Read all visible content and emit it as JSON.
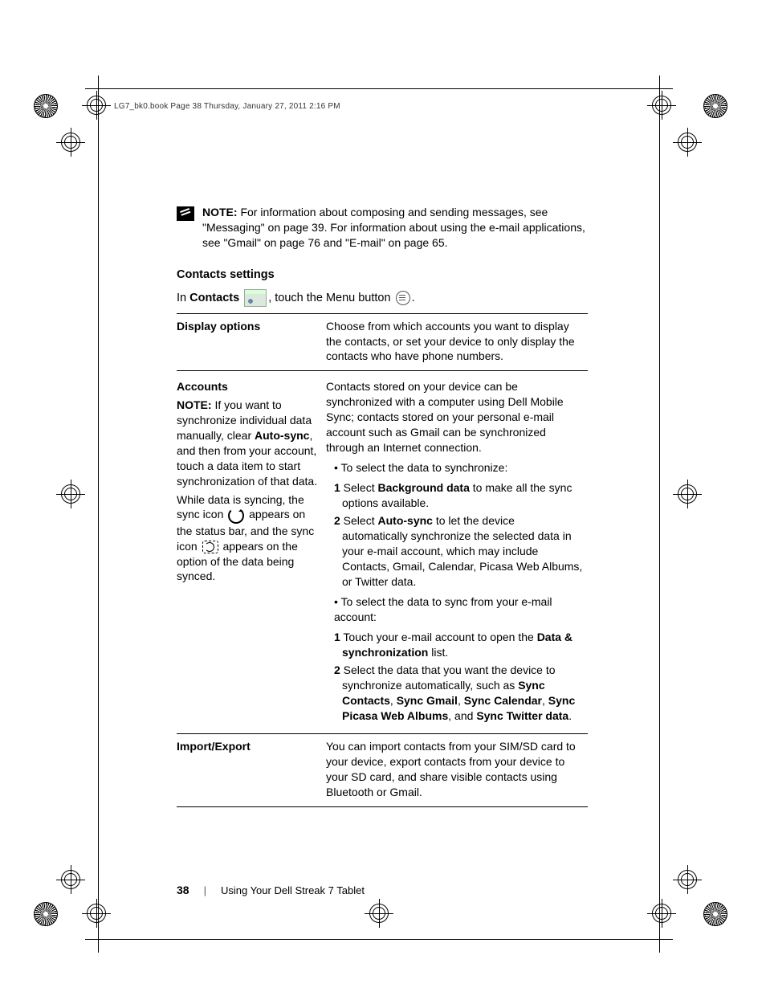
{
  "header": "LG7_bk0.book  Page 38  Thursday, January 27, 2011  2:16 PM",
  "note": {
    "label": "NOTE:",
    "text": " For information about composing and sending messages, see \"Messaging\" on page 39. For information about using the e-mail applications, see \"Gmail\" on page 76 and \"E-mail\" on page 65."
  },
  "section_heading": "Contacts settings",
  "intro": {
    "pre": "In ",
    "contacts": "Contacts",
    "mid": ", touch the Menu button ",
    "post": "."
  },
  "rows": {
    "display": {
      "left": "Display options",
      "right": "Choose from which accounts you want to display the contacts, or set your device to only display the contacts who have phone numbers."
    },
    "accounts": {
      "left_title": "Accounts",
      "left_note_label": "NOTE:",
      "left_note_1a": " If you want to synchronize individual data manually, clear ",
      "left_note_1_bold": "Auto-sync",
      "left_note_1b": ", and then from your account, touch a data item to start synchronization of that data.",
      "left_p2a": "While data is syncing, the sync icon ",
      "left_p2b": " appears on the status bar, and the sync icon ",
      "left_p2c": " appears on the option of the data being synced.",
      "right_p1": "Contacts stored on your device can be synchronized with a computer using Dell Mobile Sync; contacts stored on your personal e-mail account such as Gmail can be synchronized through an Internet connection.",
      "bullet1": "To select the data to synchronize:",
      "step1_num": "1",
      "step1_a": " Select ",
      "step1_bold": "Background data",
      "step1_b": " to make all the sync options available.",
      "step2_num": "2",
      "step2_a": " Select ",
      "step2_bold": "Auto-sync",
      "step2_b": " to let the device automatically synchronize the selected data in your e-mail account, which may include Contacts, Gmail, Calendar, Picasa Web Albums, or Twitter data.",
      "bullet2": "To select the data to sync from your e-mail account:",
      "step3_num": "1",
      "step3_a": " Touch your e-mail account to open the ",
      "step3_bold": "Data & synchronization",
      "step3_b": " list.",
      "step4_num": "2",
      "step4_a": " Select the data that you want the device to synchronize automatically, such as ",
      "sc": "Sync Contacts",
      "c1": ", ",
      "sg": "Sync Gmail",
      "c2": ", ",
      "scal": "Sync Calendar",
      "c3": ", ",
      "sp": "Sync Picasa Web Albums",
      "c4": ", and ",
      "st": "Sync Twitter data",
      "c5": "."
    },
    "import": {
      "left": "Import/Export",
      "right": "You can import contacts from your SIM/SD card to your device, export contacts from your device to your SD card, and share visible contacts using Bluetooth or Gmail."
    }
  },
  "footer": {
    "page": "38",
    "text": "Using Your Dell Streak 7 Tablet"
  }
}
